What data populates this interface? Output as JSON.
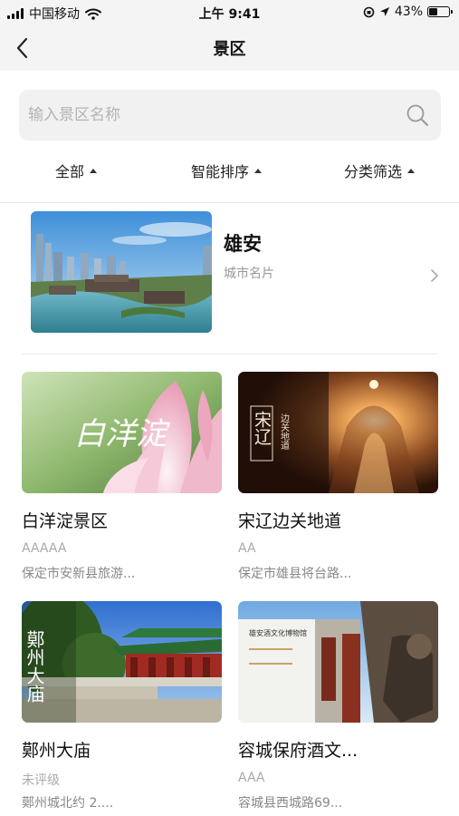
{
  "status_bar": {
    "carrier": "中国移动",
    "time": "上午 9:41",
    "battery": "43%",
    "battery_level": 0.43
  },
  "nav": {
    "title": "景区"
  },
  "search": {
    "placeholder": "输入景区名称"
  },
  "filters": [
    {
      "label": "全部"
    },
    {
      "label": "智能排序"
    },
    {
      "label": "分类筛选"
    }
  ],
  "featured": {
    "name": "雄安",
    "subtitle": "城市名片"
  },
  "scenic_spots": [
    {
      "name": "白洋淀景区",
      "level": "AAAAA",
      "address": "保定市安新县旅游...",
      "image_text": "白洋淀"
    },
    {
      "name": "宋辽边关地道",
      "level": "AA",
      "address": "保定市雄县将台路...",
      "image_text_a": "宋辽",
      "image_text_b": "边关地道"
    },
    {
      "name": "鄚州大庙",
      "level": "未评级",
      "address": "鄚州城北约 2....",
      "image_text": "鄚州大庙"
    },
    {
      "name": "容城保府酒文...",
      "level": "AAA",
      "address": "容城县西城路69...",
      "image_text": "雄安酒文化博物馆"
    }
  ],
  "colors": {
    "bar_bg": "#f4f4f4",
    "search_bg": "#f1f1f1",
    "placeholder": "#b3b3b3",
    "muted_text": "#999999"
  }
}
